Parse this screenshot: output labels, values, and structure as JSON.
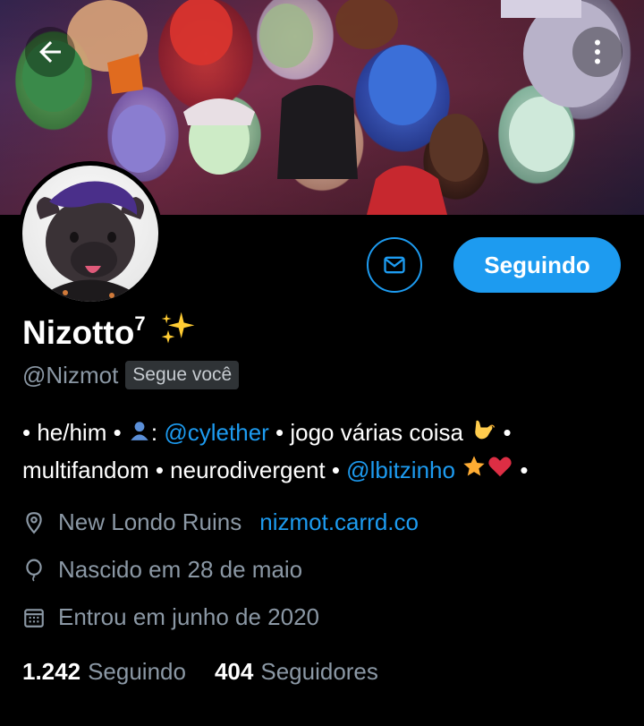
{
  "profile": {
    "name": "Nizotto",
    "name_sup": "7",
    "name_emoji": "sparkles-icon",
    "handle": "@Nizmot",
    "follows_you": "Segue você"
  },
  "actions": {
    "message_icon": "envelope-icon",
    "follow_label": "Seguindo"
  },
  "bio": {
    "part1": "• he/him • ",
    "part2": ": ",
    "mention1": "@cylether",
    "part3": " • jogo várias coisa ",
    "part4": " • multifandom • neurodivergent • ",
    "mention2": "@lbitzinho",
    "part5": " •"
  },
  "meta": {
    "location": "New Londo Ruins",
    "website": "nizmot.carrd.co",
    "birthday": "Nascido em 28 de maio",
    "joined": "Entrou em junho de 2020"
  },
  "stats": {
    "following_count": "1.242",
    "following_label": "Seguindo",
    "followers_count": "404",
    "followers_label": "Seguidores"
  },
  "colors": {
    "accent": "#1d9bf0",
    "muted": "#8b98a5",
    "background": "#000000"
  }
}
